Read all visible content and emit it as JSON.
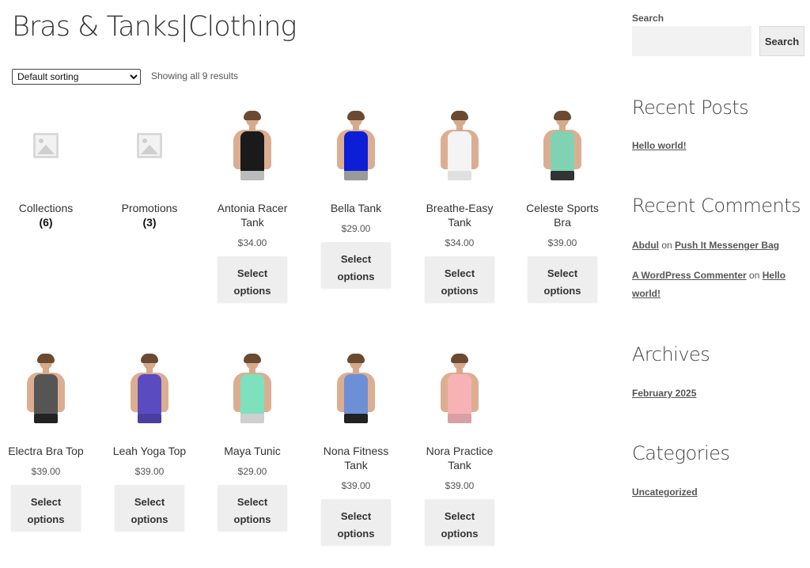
{
  "page": {
    "title": "Bras & Tanks|Clothing",
    "sorting": {
      "selected": "Default sorting"
    },
    "result_count": "Showing all 9 results"
  },
  "categories": [
    {
      "name": "Collections",
      "count": "(6)"
    },
    {
      "name": "Promotions",
      "count": "(3)"
    }
  ],
  "products": [
    {
      "name": "Antonia Racer Tank",
      "price": "$34.00",
      "button": "Select options",
      "top_color": "#1a1a1a",
      "shorts_color": "#bbbbbb"
    },
    {
      "name": "Bella Tank",
      "price": "$29.00",
      "button": "Select options",
      "top_color": "#0d1fd6",
      "shorts_color": "#9a9a9a"
    },
    {
      "name": "Breathe-Easy Tank",
      "price": "$34.00",
      "button": "Select options",
      "top_color": "#f4f4f4",
      "shorts_color": "#e0e0e0"
    },
    {
      "name": "Celeste Sports Bra",
      "price": "$39.00",
      "button": "Select options",
      "top_color": "#7fd3b3",
      "shorts_color": "#333333"
    },
    {
      "name": "Electra Bra Top",
      "price": "$39.00",
      "button": "Select options",
      "top_color": "#555555",
      "shorts_color": "#222222"
    },
    {
      "name": "Leah Yoga Top",
      "price": "$39.00",
      "button": "Select options",
      "top_color": "#5a4cc0",
      "shorts_color": "#4a3fa0"
    },
    {
      "name": "Maya Tunic",
      "price": "$29.00",
      "button": "Select options",
      "top_color": "#7fe0bd",
      "shorts_color": "#cfcfcf"
    },
    {
      "name": "Nona Fitness Tank",
      "price": "$39.00",
      "button": "Select options",
      "top_color": "#6d8fd6",
      "shorts_color": "#222222"
    },
    {
      "name": "Nora Practice Tank",
      "price": "$39.00",
      "button": "Select options",
      "top_color": "#f7b2b6",
      "shorts_color": "#d8a0a5"
    }
  ],
  "sidebar": {
    "search": {
      "label": "Search",
      "button": "Search",
      "value": ""
    },
    "recent_posts": {
      "title": "Recent Posts",
      "items": [
        "Hello world!"
      ]
    },
    "recent_comments": {
      "title": "Recent Comments",
      "items": [
        {
          "author": "Abdul",
          "on": "on",
          "post": "Push It Messenger Bag"
        },
        {
          "author": "A WordPress Commenter",
          "on": "on",
          "post": "Hello world!"
        }
      ]
    },
    "archives": {
      "title": "Archives",
      "items": [
        "February 2025"
      ]
    },
    "categories": {
      "title": "Categories",
      "items": [
        "Uncategorized"
      ]
    }
  }
}
